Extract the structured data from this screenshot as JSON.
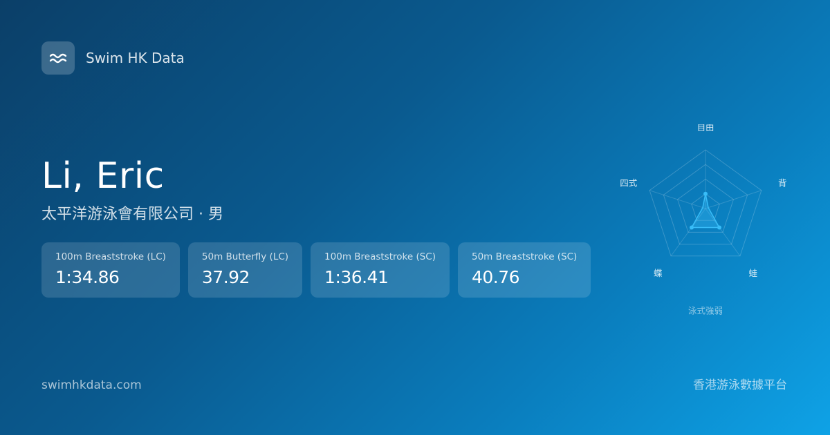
{
  "brand": {
    "name": "Swim HK Data",
    "logo_icon": "waves-icon"
  },
  "swimmer": {
    "name": "Li, Eric",
    "subtitle": "太平洋游泳會有限公司 · 男"
  },
  "stats": [
    {
      "label": "100m Breaststroke (LC)",
      "value": "1:34.86"
    },
    {
      "label": "50m Butterfly (LC)",
      "value": "37.92"
    },
    {
      "label": "100m Breaststroke (SC)",
      "value": "1:36.41"
    },
    {
      "label": "50m Breaststroke (SC)",
      "value": "40.76"
    }
  ],
  "chart_data": {
    "type": "radar",
    "title": "泳式強弱",
    "axes": [
      "自由",
      "背",
      "蛙",
      "蝶",
      "四式"
    ],
    "rings": 4,
    "max": 1,
    "values": [
      0.25,
      0.05,
      0.4,
      0.4,
      0.05
    ],
    "color": "#38bdf8"
  },
  "footer": {
    "url": "swimhkdata.com",
    "tagline": "香港游泳數據平台"
  },
  "colors": {
    "bg_start": "#0b3f68",
    "bg_end": "#0ea2e6",
    "accent": "#38bdf8"
  }
}
